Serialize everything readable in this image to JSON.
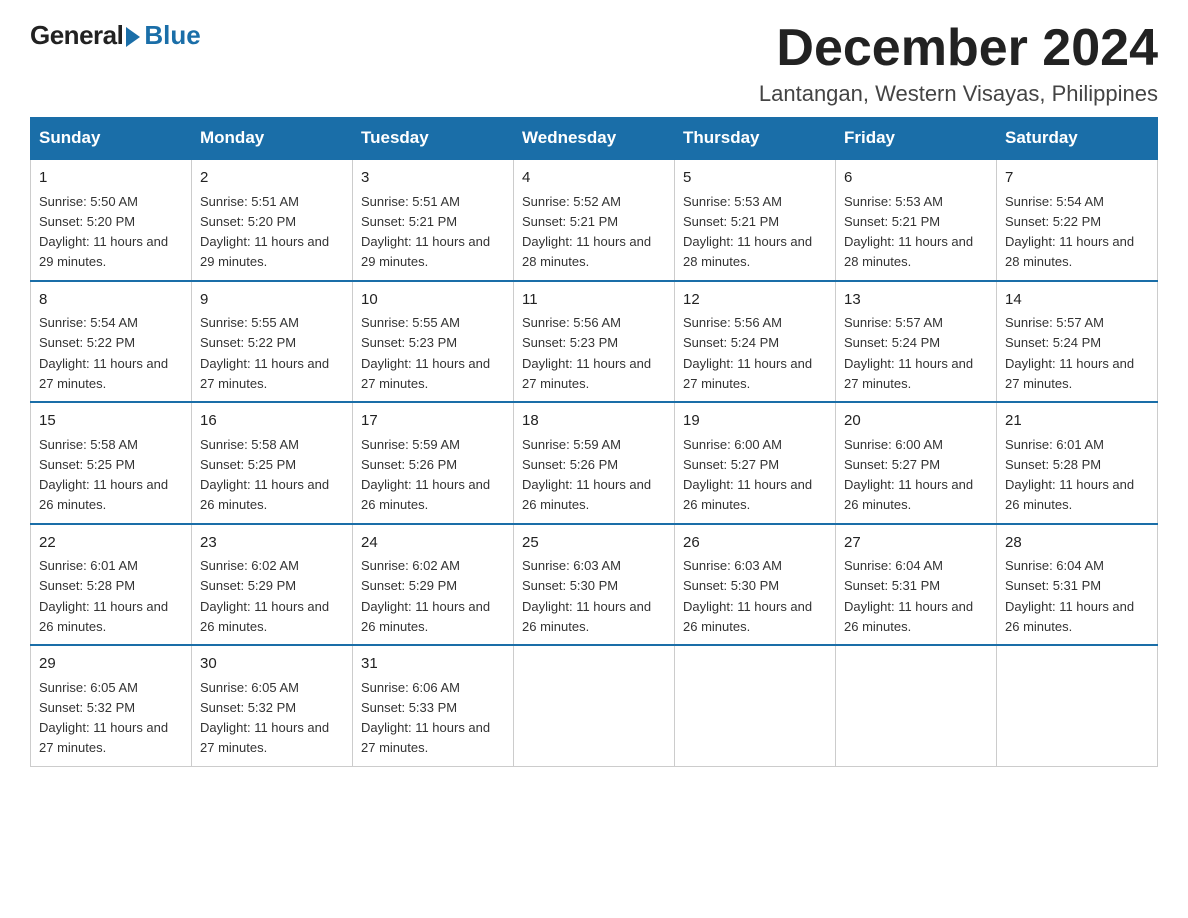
{
  "logo": {
    "general": "General",
    "blue": "Blue"
  },
  "title": "December 2024",
  "subtitle": "Lantangan, Western Visayas, Philippines",
  "days_of_week": [
    "Sunday",
    "Monday",
    "Tuesday",
    "Wednesday",
    "Thursday",
    "Friday",
    "Saturday"
  ],
  "weeks": [
    [
      {
        "day": "1",
        "sunrise": "5:50 AM",
        "sunset": "5:20 PM",
        "daylight": "11 hours and 29 minutes."
      },
      {
        "day": "2",
        "sunrise": "5:51 AM",
        "sunset": "5:20 PM",
        "daylight": "11 hours and 29 minutes."
      },
      {
        "day": "3",
        "sunrise": "5:51 AM",
        "sunset": "5:21 PM",
        "daylight": "11 hours and 29 minutes."
      },
      {
        "day": "4",
        "sunrise": "5:52 AM",
        "sunset": "5:21 PM",
        "daylight": "11 hours and 28 minutes."
      },
      {
        "day": "5",
        "sunrise": "5:53 AM",
        "sunset": "5:21 PM",
        "daylight": "11 hours and 28 minutes."
      },
      {
        "day": "6",
        "sunrise": "5:53 AM",
        "sunset": "5:21 PM",
        "daylight": "11 hours and 28 minutes."
      },
      {
        "day": "7",
        "sunrise": "5:54 AM",
        "sunset": "5:22 PM",
        "daylight": "11 hours and 28 minutes."
      }
    ],
    [
      {
        "day": "8",
        "sunrise": "5:54 AM",
        "sunset": "5:22 PM",
        "daylight": "11 hours and 27 minutes."
      },
      {
        "day": "9",
        "sunrise": "5:55 AM",
        "sunset": "5:22 PM",
        "daylight": "11 hours and 27 minutes."
      },
      {
        "day": "10",
        "sunrise": "5:55 AM",
        "sunset": "5:23 PM",
        "daylight": "11 hours and 27 minutes."
      },
      {
        "day": "11",
        "sunrise": "5:56 AM",
        "sunset": "5:23 PM",
        "daylight": "11 hours and 27 minutes."
      },
      {
        "day": "12",
        "sunrise": "5:56 AM",
        "sunset": "5:24 PM",
        "daylight": "11 hours and 27 minutes."
      },
      {
        "day": "13",
        "sunrise": "5:57 AM",
        "sunset": "5:24 PM",
        "daylight": "11 hours and 27 minutes."
      },
      {
        "day": "14",
        "sunrise": "5:57 AM",
        "sunset": "5:24 PM",
        "daylight": "11 hours and 27 minutes."
      }
    ],
    [
      {
        "day": "15",
        "sunrise": "5:58 AM",
        "sunset": "5:25 PM",
        "daylight": "11 hours and 26 minutes."
      },
      {
        "day": "16",
        "sunrise": "5:58 AM",
        "sunset": "5:25 PM",
        "daylight": "11 hours and 26 minutes."
      },
      {
        "day": "17",
        "sunrise": "5:59 AM",
        "sunset": "5:26 PM",
        "daylight": "11 hours and 26 minutes."
      },
      {
        "day": "18",
        "sunrise": "5:59 AM",
        "sunset": "5:26 PM",
        "daylight": "11 hours and 26 minutes."
      },
      {
        "day": "19",
        "sunrise": "6:00 AM",
        "sunset": "5:27 PM",
        "daylight": "11 hours and 26 minutes."
      },
      {
        "day": "20",
        "sunrise": "6:00 AM",
        "sunset": "5:27 PM",
        "daylight": "11 hours and 26 minutes."
      },
      {
        "day": "21",
        "sunrise": "6:01 AM",
        "sunset": "5:28 PM",
        "daylight": "11 hours and 26 minutes."
      }
    ],
    [
      {
        "day": "22",
        "sunrise": "6:01 AM",
        "sunset": "5:28 PM",
        "daylight": "11 hours and 26 minutes."
      },
      {
        "day": "23",
        "sunrise": "6:02 AM",
        "sunset": "5:29 PM",
        "daylight": "11 hours and 26 minutes."
      },
      {
        "day": "24",
        "sunrise": "6:02 AM",
        "sunset": "5:29 PM",
        "daylight": "11 hours and 26 minutes."
      },
      {
        "day": "25",
        "sunrise": "6:03 AM",
        "sunset": "5:30 PM",
        "daylight": "11 hours and 26 minutes."
      },
      {
        "day": "26",
        "sunrise": "6:03 AM",
        "sunset": "5:30 PM",
        "daylight": "11 hours and 26 minutes."
      },
      {
        "day": "27",
        "sunrise": "6:04 AM",
        "sunset": "5:31 PM",
        "daylight": "11 hours and 26 minutes."
      },
      {
        "day": "28",
        "sunrise": "6:04 AM",
        "sunset": "5:31 PM",
        "daylight": "11 hours and 26 minutes."
      }
    ],
    [
      {
        "day": "29",
        "sunrise": "6:05 AM",
        "sunset": "5:32 PM",
        "daylight": "11 hours and 27 minutes."
      },
      {
        "day": "30",
        "sunrise": "6:05 AM",
        "sunset": "5:32 PM",
        "daylight": "11 hours and 27 minutes."
      },
      {
        "day": "31",
        "sunrise": "6:06 AM",
        "sunset": "5:33 PM",
        "daylight": "11 hours and 27 minutes."
      },
      null,
      null,
      null,
      null
    ]
  ]
}
